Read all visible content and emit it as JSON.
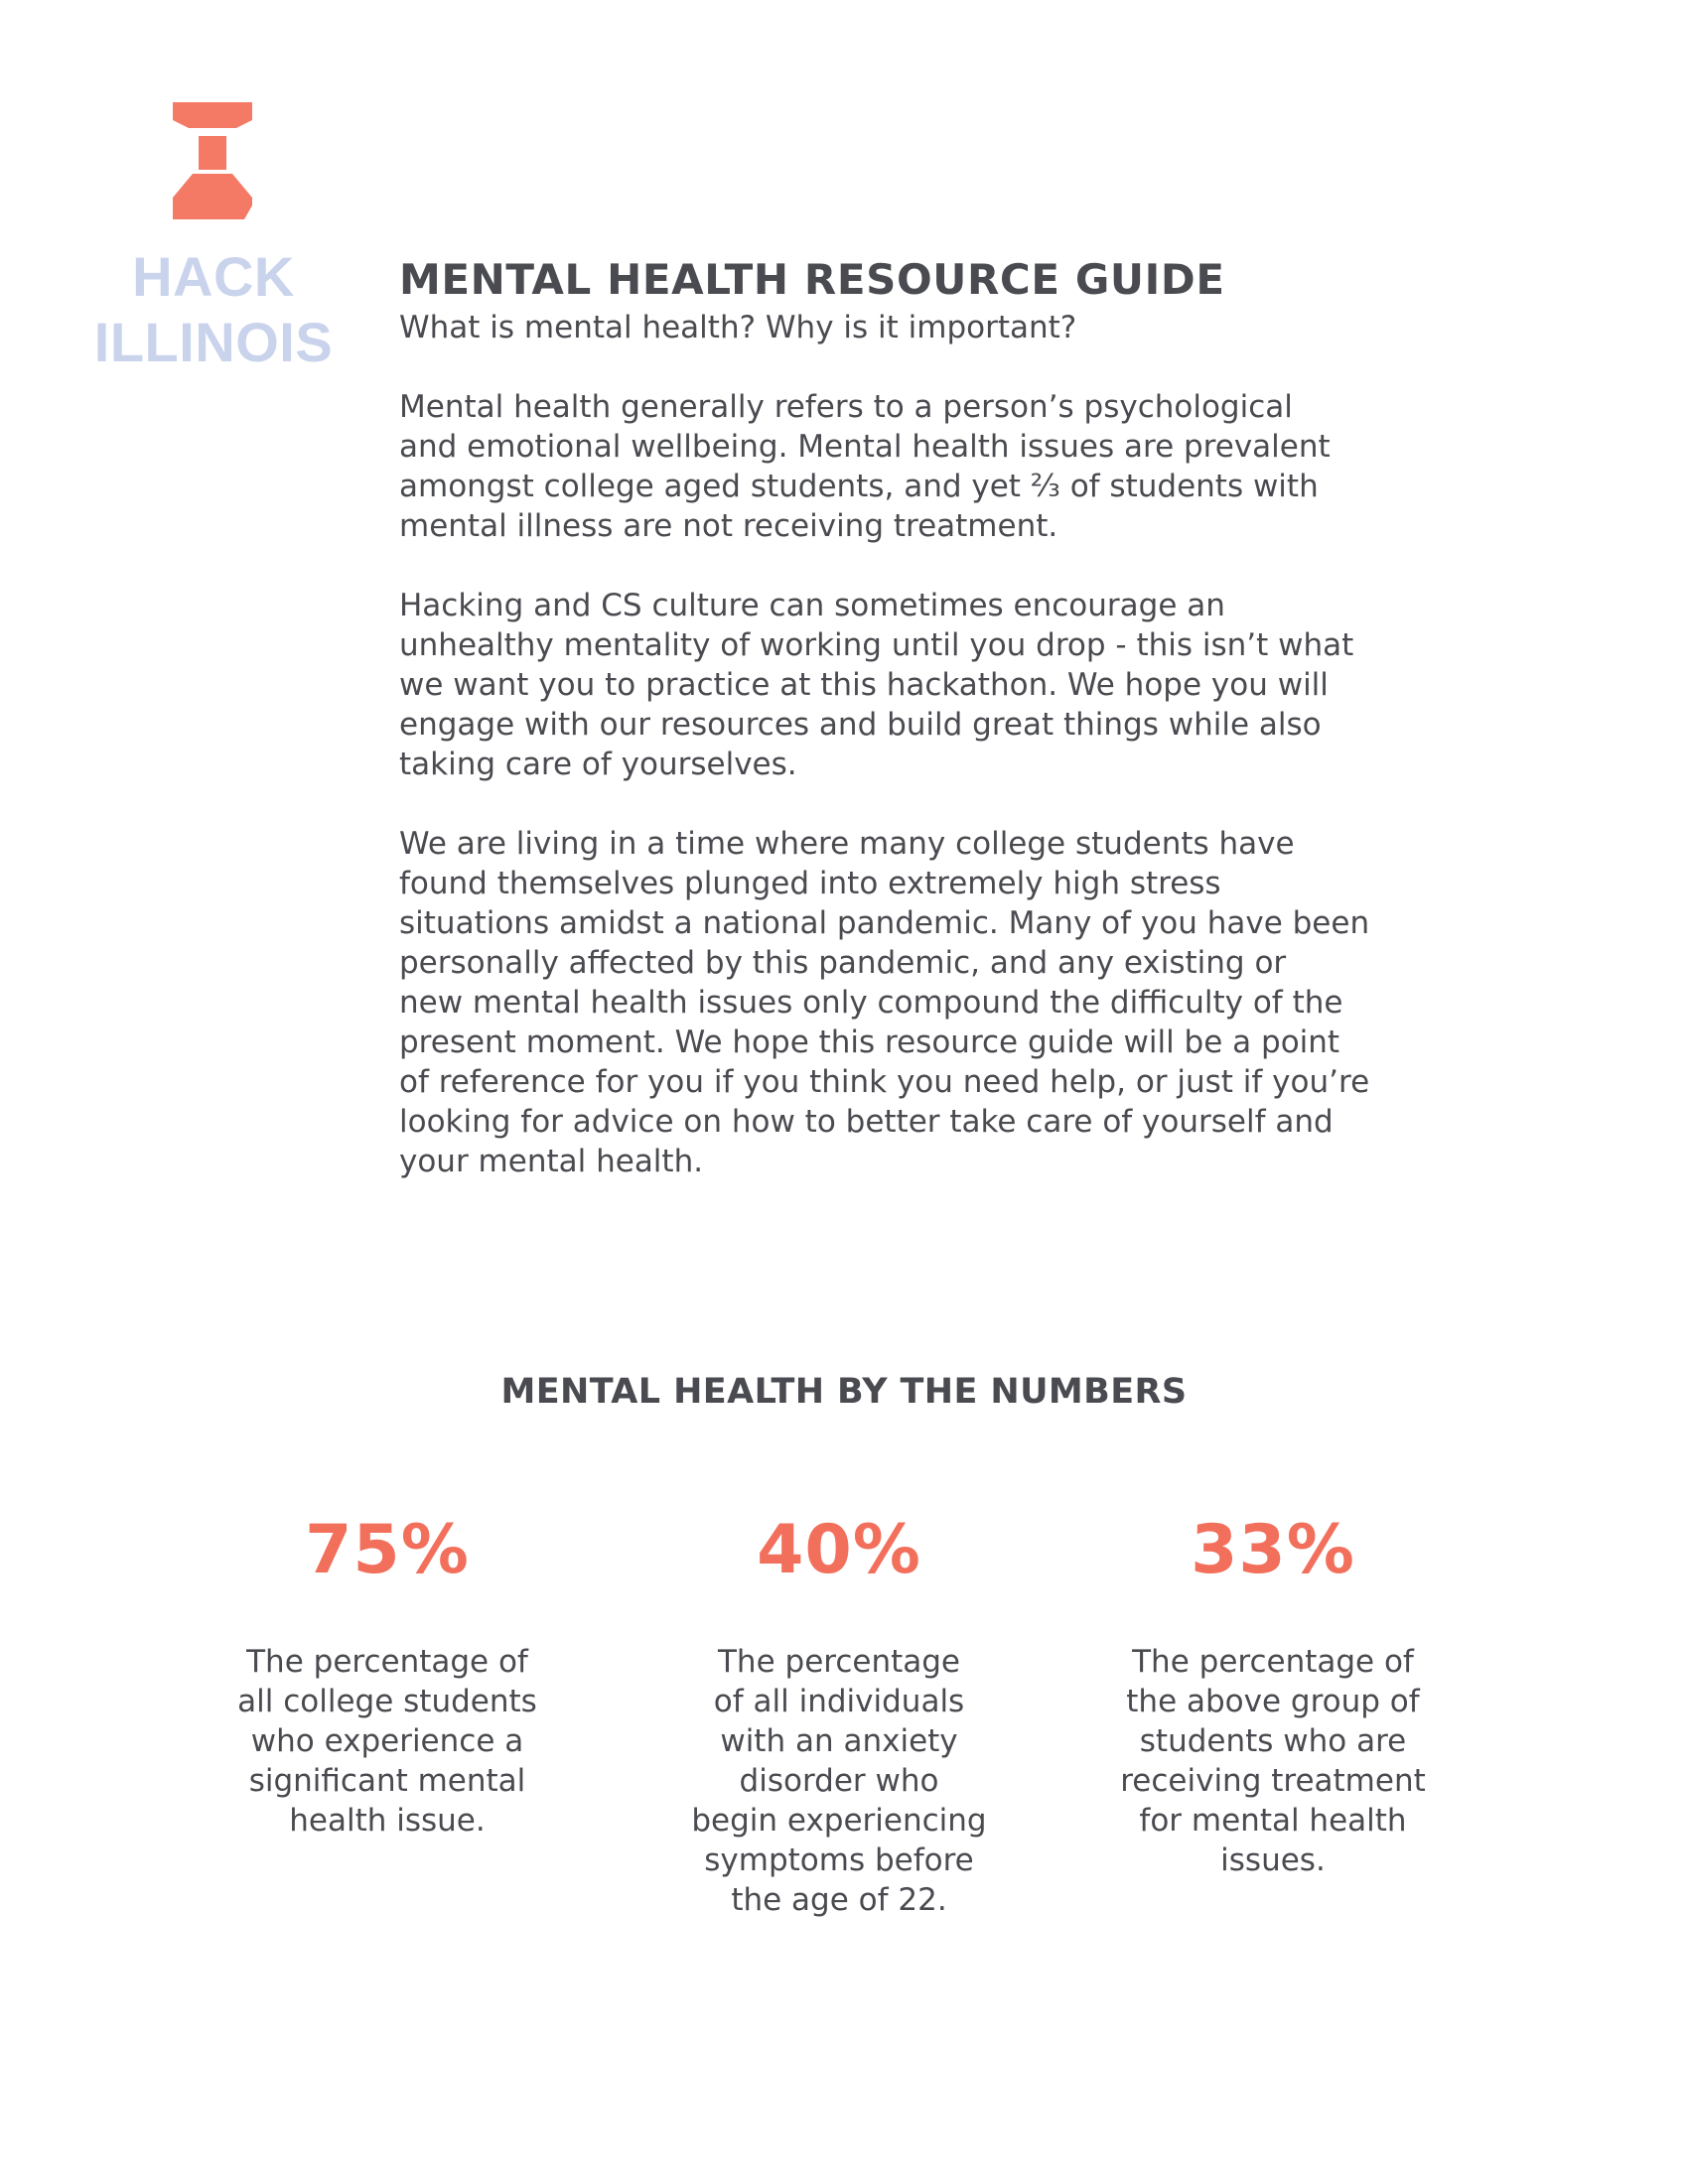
{
  "logo": {
    "lines": [
      "HACK",
      "ILLINOIS"
    ],
    "mark_color": "#f47a66",
    "text_color": "#c9d3ec"
  },
  "header": {
    "title": "MENTAL HEALTH RESOURCE GUIDE",
    "subtitle": "What is mental health? Why is it important?"
  },
  "paragraphs": [
    {
      "lines": [
        "Mental health generally refers to a person’s psychological",
        "and emotional wellbeing. Mental health issues are prevalent",
        "amongst college aged students, and yet ⅔ of students with",
        "mental illness are not receiving treatment."
      ]
    },
    {
      "lines": [
        "Hacking and CS culture can sometimes encourage an",
        "unhealthy mentality of working until you drop - this isn’t what",
        "we want you to practice at this hackathon. We hope you will",
        "engage with our resources and build great things while also",
        "taking care of yourselves."
      ]
    },
    {
      "lines": [
        "We are living in a time where many college students have",
        "found themselves plunged into extremely high stress",
        "situations amidst a national pandemic. Many of you have been",
        "personally affected by this pandemic, and any existing or",
        "new mental health issues only compound the difficulty of the",
        "present moment. We hope this resource guide will be a point",
        "of reference for you if you think you need help, or just if you’re",
        "looking for advice on how to better take care of yourself and",
        "your mental health."
      ]
    }
  ],
  "stats": {
    "title": "MENTAL HEALTH BY THE NUMBERS",
    "accent_color": "#f26f5c",
    "items": [
      {
        "value": "75%",
        "lines": [
          "The percentage of",
          "all college students",
          "who experience a",
          "significant mental",
          "health issue."
        ]
      },
      {
        "value": "40%",
        "lines": [
          "The percentage",
          "of all individuals",
          "with an anxiety",
          "disorder who",
          "begin experiencing",
          "symptoms before",
          "the age of 22."
        ]
      },
      {
        "value": "33%",
        "lines": [
          "The percentage of",
          "the above group of",
          "students who are",
          "receiving treatment",
          "for mental health",
          "issues."
        ]
      }
    ]
  }
}
